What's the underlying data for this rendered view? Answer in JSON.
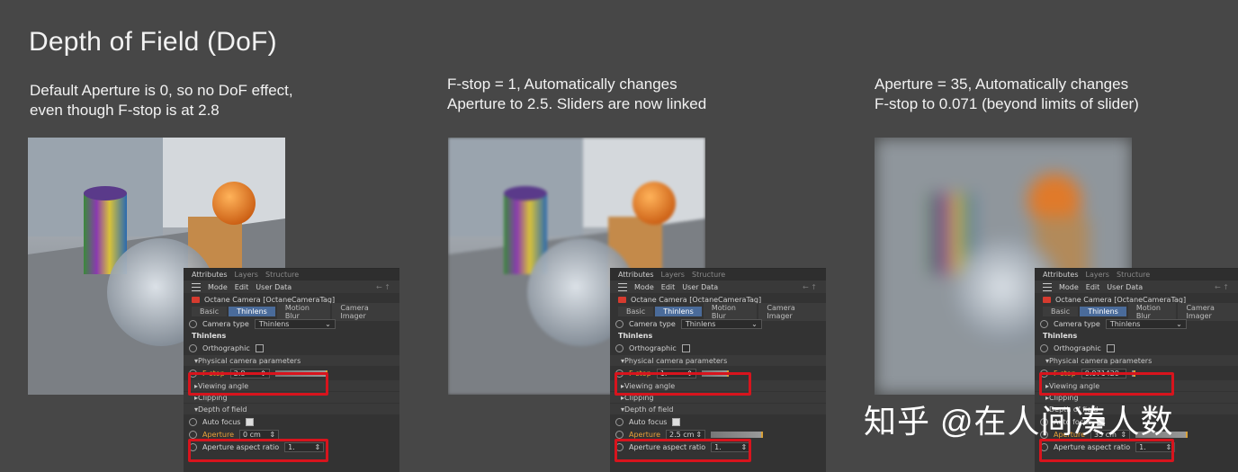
{
  "page_title": "Depth of Field (DoF)",
  "captions": [
    "Default Aperture is 0, so no DoF effect,\neven though F-stop is at 2.8",
    "F-stop = 1, Automatically changes\nAperture to 2.5. Sliders are now linked",
    "Aperture = 35, Automatically changes\nF-stop to 0.071 (beyond limits of slider)"
  ],
  "panel": {
    "tabs": [
      "Attributes",
      "Layers",
      "Structure"
    ],
    "menu": [
      "Mode",
      "Edit",
      "User Data"
    ],
    "object_name": "Octane Camera [OctaneCameraTag]",
    "sub_tabs": [
      "Basic",
      "Thinlens",
      "Motion Blur",
      "Camera Imager"
    ],
    "camera_type_label": "Camera type",
    "camera_type_value": "Thinlens",
    "section_heading": "Thinlens",
    "orthographic_label": "Orthographic",
    "physical_group": "Physical camera parameters",
    "fstop_label": "F-stop",
    "viewing_angle_group": "Viewing angle",
    "clipping_group": "Clipping",
    "dof_group": "Depth of field",
    "auto_focus_label": "Auto focus",
    "aperture_label": "Aperture",
    "aspect_label": "Aperture aspect ratio",
    "aspect_value": "1."
  },
  "panels": [
    {
      "fstop": "2.8",
      "aperture": "0 cm"
    },
    {
      "fstop": "1.",
      "aperture": "2.5 cm"
    },
    {
      "fstop": "0.071429",
      "aperture": "35 cm"
    }
  ],
  "watermark": "知乎 @在人间凑人数",
  "colors": {
    "highlight_box": "#d8141d",
    "accent_orange": "#e8a23a",
    "active_tab": "#4a6b9a"
  }
}
